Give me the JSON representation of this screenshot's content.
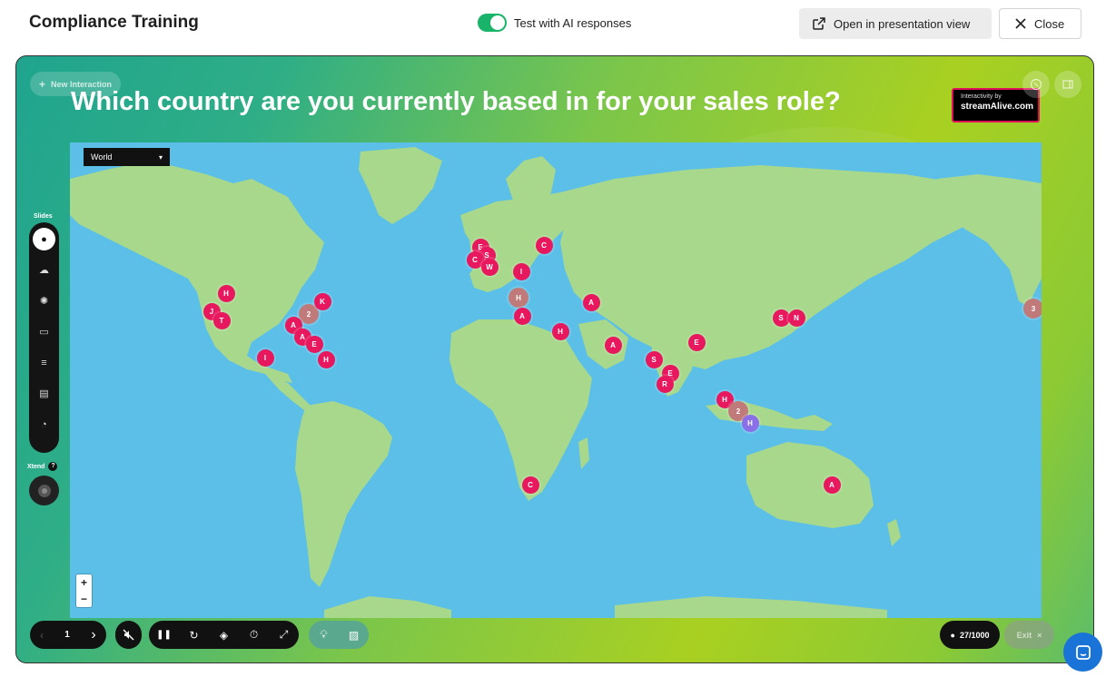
{
  "header": {
    "title": "Compliance Training",
    "ai_toggle_label": "Test with AI responses",
    "ai_toggle_on": true,
    "present_button": "Open in presentation view",
    "close_button": "Close"
  },
  "stage": {
    "new_interaction": "New Interaction",
    "question": "Which country are you currently based in for your sales role?",
    "logo_small": "Interactivity by",
    "logo_brand": "streamAlive.com",
    "map_region": "World",
    "zoom_in": "+",
    "zoom_out": "−",
    "slides_label": "Slides",
    "xtend_label": "Xtend",
    "page_number": "1",
    "participants": "27/1000",
    "exit_label": "Exit",
    "colors": {
      "marker": "#e8185e",
      "cluster": "#c07a7a",
      "accent_toggle": "#19b369",
      "ocean": "#5bbfe8",
      "land": "#a8d88c"
    }
  },
  "markers": [
    {
      "label": "H",
      "type": "single"
    },
    {
      "label": "J",
      "type": "single"
    },
    {
      "label": "T",
      "type": "single"
    },
    {
      "label": "2",
      "type": "cluster"
    },
    {
      "label": "K",
      "type": "single"
    },
    {
      "label": "A",
      "type": "single"
    },
    {
      "label": "A",
      "type": "single"
    },
    {
      "label": "E",
      "type": "single"
    },
    {
      "label": "H",
      "type": "single"
    },
    {
      "label": "I",
      "type": "single"
    },
    {
      "label": "E",
      "type": "single"
    },
    {
      "label": "S",
      "type": "single"
    },
    {
      "label": "C",
      "type": "single"
    },
    {
      "label": "W",
      "type": "single"
    },
    {
      "label": "C",
      "type": "single"
    },
    {
      "label": "I",
      "type": "single"
    },
    {
      "label": "H",
      "type": "cluster"
    },
    {
      "label": "A",
      "type": "single"
    },
    {
      "label": "A",
      "type": "single"
    },
    {
      "label": "H",
      "type": "single"
    },
    {
      "label": "A",
      "type": "single"
    },
    {
      "label": "E",
      "type": "single"
    },
    {
      "label": "S",
      "type": "single"
    },
    {
      "label": "E",
      "type": "single"
    },
    {
      "label": "R",
      "type": "single"
    },
    {
      "label": "H",
      "type": "single"
    },
    {
      "label": "2",
      "type": "cluster"
    },
    {
      "label": "H",
      "type": "alt"
    },
    {
      "label": "S",
      "type": "single"
    },
    {
      "label": "N",
      "type": "single"
    },
    {
      "label": "3",
      "type": "cluster"
    },
    {
      "label": "C",
      "type": "single"
    },
    {
      "label": "A",
      "type": "single"
    }
  ]
}
